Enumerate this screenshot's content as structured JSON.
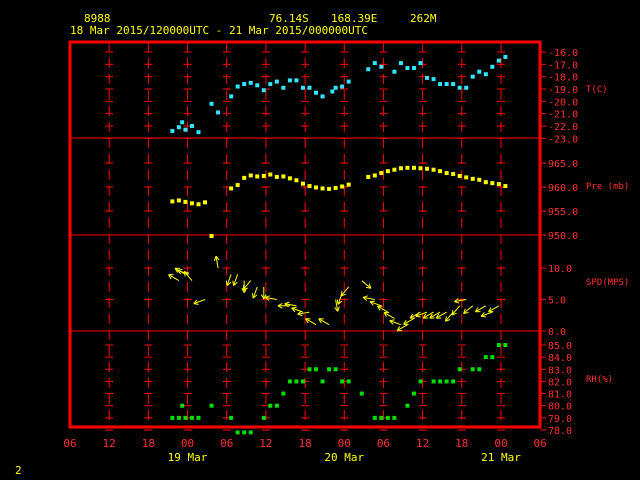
{
  "header": {
    "station_id": "8988",
    "lat": "76.14S",
    "lon": "168.39E",
    "elevation": "262M",
    "time_range": "18 Mar 2015/120000UTC - 21 Mar 2015/000000UTC"
  },
  "page_number": "2",
  "colors": {
    "frame": "#ff0000",
    "grid": "#ff0000",
    "axis_text": "#ff3030",
    "header_text": "#ffff00",
    "date_text": "#ffff00",
    "temperature": "#33e6ff",
    "pressure": "#ffff00",
    "wind": "#ffff00",
    "rh": "#00dd00"
  },
  "chart_data": {
    "type": "scatter",
    "x_axis": {
      "unit": "hour",
      "range_hours": [
        -6,
        66
      ],
      "tick_labels": [
        "06",
        "12",
        "18",
        "00",
        "06",
        "12",
        "18",
        "00",
        "06",
        "12",
        "18",
        "00",
        "06"
      ],
      "date_labels": [
        {
          "label": "19 Mar",
          "hour": 12
        },
        {
          "label": "20 Mar",
          "hour": 36
        },
        {
          "label": "21 Mar",
          "hour": 60
        }
      ]
    },
    "panels": [
      {
        "name": "temperature",
        "ylabel": "T(C)",
        "ylim": [
          -23,
          -15
        ],
        "ticks": [
          "-16.0",
          "-17.0",
          "-18.0",
          "-19.0",
          "-20.0",
          "-21.0",
          "-22.0",
          "-23.0"
        ],
        "tick_values": [
          -16,
          -17,
          -18,
          -19,
          -20,
          -21,
          -22,
          -23
        ],
        "x": [
          0,
          1,
          1.5,
          2,
          3,
          4,
          6,
          7,
          9,
          10,
          11,
          12,
          13,
          14,
          15,
          16,
          17,
          18,
          19,
          20,
          21,
          22,
          23,
          24.5,
          25,
          26,
          27,
          30,
          31,
          32,
          34,
          35,
          36,
          37,
          38,
          39,
          40,
          41,
          42,
          43,
          44,
          45,
          46,
          47,
          48,
          49,
          50,
          51
        ],
        "y": [
          -22.4,
          -22.1,
          -21.7,
          -22.3,
          -22.0,
          -22.5,
          -20.2,
          -20.9,
          -19.6,
          -18.8,
          -18.6,
          -18.5,
          -18.7,
          -19.1,
          -18.6,
          -18.4,
          -18.9,
          -18.3,
          -18.3,
          -18.9,
          -18.9,
          -19.3,
          -19.6,
          -19.2,
          -18.9,
          -18.8,
          -18.4,
          -17.4,
          -16.9,
          -17.2,
          -17.6,
          -16.9,
          -17.3,
          -17.3,
          -16.9,
          -18.1,
          -18.2,
          -18.6,
          -18.6,
          -18.6,
          -18.9,
          -18.9,
          -18.0,
          -17.6,
          -17.8,
          -17.2,
          -16.7,
          -16.4
        ],
        "connected": false
      },
      {
        "name": "pressure",
        "ylabel": "Pre (mb)",
        "ylim": [
          949,
          968
        ],
        "ticks": [
          "965.0",
          "960.0",
          "955.0",
          "950.0"
        ],
        "tick_values": [
          965,
          960,
          955,
          950
        ],
        "x": [
          0,
          1,
          2,
          3,
          4,
          5,
          6,
          9,
          10,
          11,
          12,
          13,
          14,
          15,
          16,
          17,
          18,
          19,
          20,
          21,
          22,
          23,
          24,
          25,
          26,
          27,
          30,
          31,
          32,
          33,
          34,
          35,
          36,
          37,
          38,
          39,
          40,
          41,
          42,
          43,
          44,
          45,
          46,
          47,
          48,
          49,
          50,
          51
        ],
        "y": [
          957.0,
          957.2,
          956.9,
          956.6,
          956.4,
          956.8,
          949.8,
          959.7,
          960.4,
          961.9,
          962.4,
          962.2,
          962.3,
          962.6,
          962.1,
          962.2,
          961.8,
          961.4,
          960.7,
          960.2,
          959.9,
          959.7,
          959.6,
          959.8,
          960.1,
          960.5,
          962.1,
          962.4,
          962.9,
          963.3,
          963.6,
          963.9,
          964.0,
          964.0,
          963.9,
          963.8,
          963.6,
          963.3,
          962.9,
          962.7,
          962.3,
          962.0,
          961.7,
          961.5,
          961.0,
          960.8,
          960.6,
          960.2
        ],
        "connected": false
      },
      {
        "name": "wind",
        "ylabel": "SPD(MPS)",
        "ylim": [
          0,
          12
        ],
        "ticks": [
          "10.0",
          "5.0",
          "0.0"
        ],
        "tick_values": [
          10,
          5,
          0
        ],
        "x": [
          1,
          2,
          2.5,
          3,
          5,
          7,
          9,
          10,
          11,
          12,
          13,
          14,
          16,
          18,
          19,
          20,
          21,
          22,
          24,
          25,
          26,
          27,
          29,
          31,
          32,
          33,
          34,
          35,
          36,
          37,
          38,
          39,
          40,
          41,
          42,
          43,
          44,
          45,
          46,
          48,
          49,
          50
        ],
        "y": [
          8,
          9,
          9,
          8,
          5,
          10,
          9,
          9,
          8,
          8,
          7,
          7,
          5,
          4,
          4,
          3,
          3,
          1,
          1,
          5,
          6,
          7,
          8,
          5,
          4,
          3,
          2,
          1,
          1,
          2,
          3,
          3,
          3,
          3,
          3,
          3,
          4,
          5,
          4,
          4,
          3,
          4
        ],
        "direction_deg": [
          300,
          300,
          290,
          320,
          250,
          350,
          200,
          200,
          180,
          220,
          200,
          180,
          280,
          270,
          280,
          290,
          260,
          300,
          300,
          170,
          200,
          220,
          130,
          280,
          290,
          300,
          300,
          290,
          240,
          240,
          240,
          250,
          240,
          240,
          240,
          220,
          220,
          260,
          230,
          240,
          250,
          240
        ],
        "marker": "arrow"
      },
      {
        "name": "rh",
        "ylabel": "RH(%)",
        "ylim": [
          77.5,
          86
        ],
        "ticks": [
          "85.0",
          "84.0",
          "83.0",
          "82.0",
          "81.0",
          "80.0",
          "79.0",
          "78.0"
        ],
        "tick_values": [
          85,
          84,
          83,
          82,
          81,
          80,
          79,
          78
        ],
        "x": [
          0,
          1,
          1.5,
          2,
          3,
          4,
          6,
          9,
          10,
          11,
          12,
          14,
          15,
          16,
          17,
          18,
          19,
          20,
          21,
          22,
          23,
          24,
          25,
          26,
          27,
          29,
          31,
          32,
          33,
          34,
          36,
          37,
          38,
          40,
          41,
          42,
          43,
          44,
          46,
          47,
          48,
          49,
          50,
          51
        ],
        "y": [
          79,
          79,
          80,
          79,
          79,
          79,
          80,
          79,
          77.8,
          77.8,
          77.8,
          79,
          80,
          80,
          81,
          82,
          82,
          82,
          83,
          83,
          82,
          83,
          83,
          82,
          82,
          81,
          79,
          79,
          79,
          79,
          80,
          81,
          82,
          82,
          82,
          82,
          82,
          83,
          83,
          83,
          84,
          84,
          85,
          85
        ],
        "connected": false
      }
    ]
  }
}
